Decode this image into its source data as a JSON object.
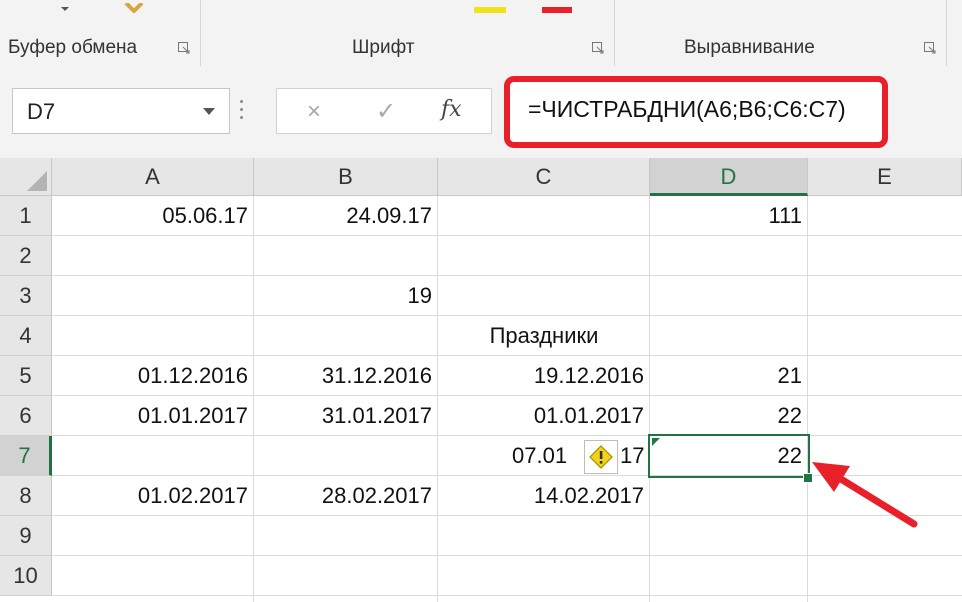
{
  "ribbon": {
    "groups": [
      {
        "label": "Буфер обмена"
      },
      {
        "label": "Шрифт"
      },
      {
        "label": "Выравнивание"
      }
    ],
    "launcher_icon": "dialog-launcher-icon"
  },
  "formula_bar": {
    "name_box": "D7",
    "formula": "=ЧИСТРАБДНИ(A6;B6;C6:C7)",
    "fx_label": "fx",
    "cancel_icon": "×",
    "enter_icon": "✓"
  },
  "grid": {
    "columns": [
      "A",
      "B",
      "C",
      "D",
      "E"
    ],
    "rows": [
      "1",
      "2",
      "3",
      "4",
      "5",
      "6",
      "7",
      "8",
      "9",
      "10"
    ],
    "active_cell": "D7",
    "cells": {
      "A1": "05.06.17",
      "B1": "24.09.17",
      "D1": "111",
      "B3": "19",
      "C4": "Праздники",
      "A5": "01.12.2016",
      "B5": "31.12.2016",
      "C5": "19.12.2016",
      "D5": "21",
      "A6": "01.01.2017",
      "B6": "31.01.2017",
      "C6": "01.01.2017",
      "D6": "22",
      "C7_left": "07.01",
      "C7_right": "17",
      "D7": "22",
      "A8": "01.02.2017",
      "B8": "28.02.2017",
      "C8": "14.02.2017"
    }
  },
  "colors": {
    "excel_green": "#217346",
    "highlight_red": "#e8202a",
    "warning_yellow": "#f2d21b"
  }
}
